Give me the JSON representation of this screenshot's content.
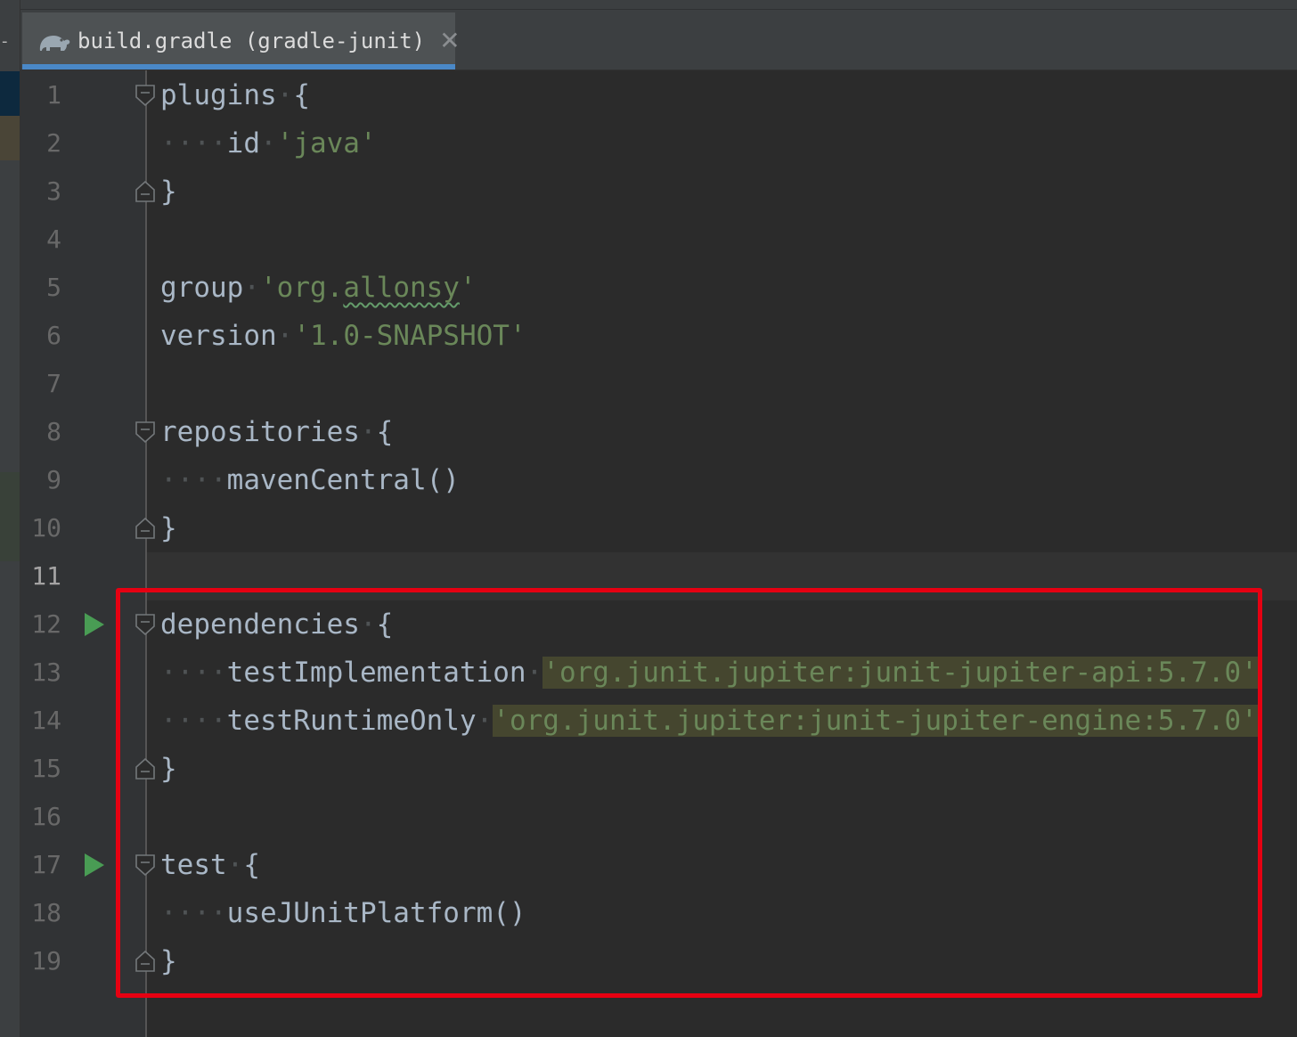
{
  "tab": {
    "title": "build.gradle (gradle-junit)",
    "icon": "gradle-elephant-icon",
    "close_glyph": "✕"
  },
  "editor": {
    "current_line": 11,
    "lines": [
      {
        "n": "1"
      },
      {
        "n": "2"
      },
      {
        "n": "3"
      },
      {
        "n": "4"
      },
      {
        "n": "5"
      },
      {
        "n": "6"
      },
      {
        "n": "7"
      },
      {
        "n": "8"
      },
      {
        "n": "9"
      },
      {
        "n": "10"
      },
      {
        "n": "11"
      },
      {
        "n": "12"
      },
      {
        "n": "13"
      },
      {
        "n": "14"
      },
      {
        "n": "15"
      },
      {
        "n": "16"
      },
      {
        "n": "17"
      },
      {
        "n": "18"
      },
      {
        "n": "19"
      }
    ],
    "tokens": {
      "plugins": "plugins",
      "open_brace": "{",
      "close_brace": "}",
      "id": "id",
      "java": "'java'",
      "group": "group",
      "group_val_a": "'org.",
      "group_val_b": "allonsy",
      "group_val_c": "'",
      "version": "version",
      "version_val": "'1.0-SNAPSHOT'",
      "repositories": "repositories",
      "mavenCentral": "mavenCentral()",
      "dependencies": "dependencies",
      "testImplementation": "testImplementation",
      "junit_api": "'org.junit.jupiter:junit-jupiter-api:5.7.0'",
      "testRuntimeOnly": "testRuntimeOnly",
      "junit_engine": "'org.junit.jupiter:junit-jupiter-engine:5.7.0'",
      "test": "test",
      "useJUnitPlatform": "useJUnitPlatform()",
      "indent_dots": "····",
      "space_dot": "·"
    }
  },
  "colors": {
    "background": "#2b2b2b",
    "gutter": "#313335",
    "keyword_text": "#a9b7c6",
    "string": "#6a8759",
    "string_highlight_bg": "#45462f",
    "line_number": "#686868",
    "run_icon": "#499c54",
    "tab_underline": "#4a88c7",
    "annotation_box": "#e60012"
  }
}
